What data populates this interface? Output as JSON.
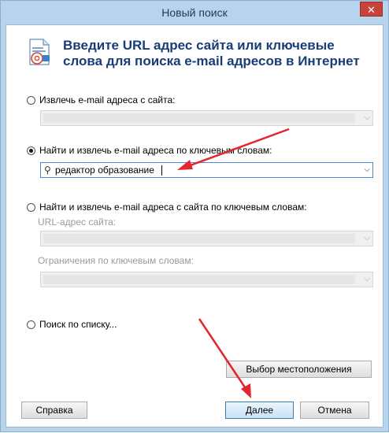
{
  "window": {
    "title": "Новый поиск",
    "close_glyph": "✕"
  },
  "header": {
    "icon": "email-search-icon",
    "text": "Введите URL адрес сайта или ключевые слова для поиска e-mail адресов в Интернет"
  },
  "options": {
    "extract_from_site": {
      "label": "Извлечь e-mail адреса с сайта:",
      "checked": false
    },
    "find_by_keywords": {
      "label": "Найти и извлечь e-mail адреса по ключевым словам:",
      "checked": true,
      "value": "редактор образование"
    },
    "site_and_keywords": {
      "label": "Найти и извлечь e-mail адреса с сайта по ключевым словам:",
      "checked": false,
      "url_label": "URL-адрес сайта:",
      "keywords_label": "Ограничения по ключевым словам:"
    },
    "search_by_list": {
      "label": "Поиск по списку...",
      "checked": false
    }
  },
  "buttons": {
    "choose_location": "Выбор местоположения",
    "help": "Справка",
    "next": "Далее",
    "cancel": "Отмена"
  },
  "icons": {
    "dropdown": "chevron-down-icon",
    "search": "magnifier-icon"
  },
  "colors": {
    "title_bar": "#b8d3ec",
    "header_text": "#1a3c78",
    "annotation_arrow": "#e3262d",
    "close": "#c7423a"
  }
}
